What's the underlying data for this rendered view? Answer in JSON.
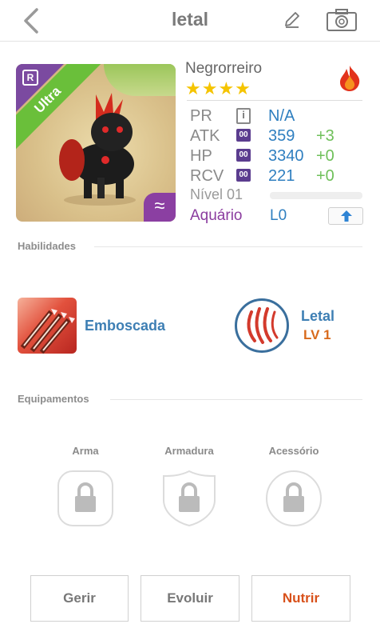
{
  "header": {
    "title": "letal"
  },
  "monster": {
    "rarity_ribbon": "Ultra",
    "rarity_badge": "R",
    "name": "Negrorreiro",
    "stars": "★★★★",
    "element_icon": "fire-icon",
    "attribute_icon": "water-waves-icon"
  },
  "stats": [
    {
      "label": "PR",
      "icon": "i",
      "value": "N/A",
      "bonus": ""
    },
    {
      "label": "ATK",
      "icon": "00",
      "value": "359",
      "bonus": "+3"
    },
    {
      "label": "HP",
      "icon": "00",
      "value": "3340",
      "bonus": "+0"
    },
    {
      "label": "RCV",
      "icon": "00",
      "value": "221",
      "bonus": "+0"
    }
  ],
  "level": {
    "label": "Nível 01",
    "progress": 0
  },
  "aquarium": {
    "label": "Aquário",
    "level": "L0"
  },
  "skills": {
    "section_title": "Habilidades",
    "active": {
      "name": "Emboscada"
    },
    "passive": {
      "name": "Letal",
      "level": "LV 1"
    }
  },
  "equipment": {
    "section_title": "Equipamentos",
    "slots": [
      {
        "label": "Arma"
      },
      {
        "label": "Armadura"
      },
      {
        "label": "Acessório"
      }
    ]
  },
  "actions": {
    "manage": "Gerir",
    "evolve": "Evoluir",
    "feed": "Nutrir"
  },
  "colors": {
    "accent_blue": "#2f7fc0",
    "bonus_green": "#6fc05a",
    "feed_orange": "#d8511b",
    "aquarium_purple": "#8b3d9f",
    "ribbon_green": "#6abf3a"
  }
}
